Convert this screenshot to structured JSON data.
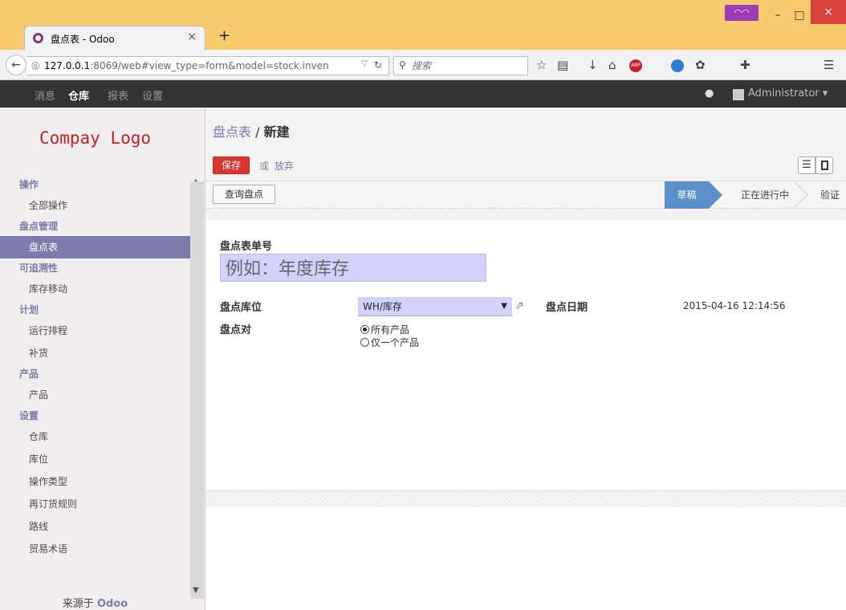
{
  "browser": {
    "tab_title": "盘点表 - Odoo",
    "new_tab": "+",
    "tab_close": "×",
    "url_host": "127.0.0.1",
    "url_rest": ":8069/web#view_type=form&model=stock.inven",
    "search_placeholder": "搜索",
    "window_close": "×",
    "window_min": "–",
    "window_max": "□"
  },
  "odoo_menu": {
    "items": [
      "消息",
      "仓库",
      "报表",
      "设置"
    ],
    "active": "仓库",
    "user": "Administrator ▾"
  },
  "sidebar": {
    "logo": "Compay Logo",
    "sections": [
      {
        "title": "操作",
        "items": [
          "全部操作"
        ]
      },
      {
        "title": "盘点管理",
        "items": [
          "盘点表"
        ]
      },
      {
        "title": "可追溯性",
        "items": [
          "库存移动"
        ]
      },
      {
        "title": "计划",
        "items": [
          "运行排程",
          "补货"
        ]
      },
      {
        "title": "产品",
        "items": [
          "产品"
        ]
      },
      {
        "title": "设置",
        "items": [
          "仓库",
          "库位",
          "操作类型",
          "再订货规则",
          "路线",
          "贸易术语"
        ]
      }
    ],
    "active_item": "盘点表",
    "powered_prefix": "来源于",
    "powered_brand": "Odoo"
  },
  "control_panel": {
    "breadcrumb_parent": "盘点表",
    "breadcrumb_sep": " / ",
    "breadcrumb_current": "新建",
    "save_label": "保存",
    "or_label": "或",
    "discard_label": "放弃"
  },
  "statusbar": {
    "query_button": "查询盘点",
    "stages": [
      "草稿",
      "正在进行中",
      "验证"
    ],
    "active_stage": "草稿"
  },
  "form": {
    "name_label": "盘点表单号",
    "name_placeholder": "例如：年度库存",
    "location_label": "盘点库位",
    "location_value": "WH/库存",
    "date_label": "盘点日期",
    "date_value": "2015-04-16 12:14:56",
    "filter_label": "盘点对",
    "filter_options": [
      "所有产品",
      "仅一个产品"
    ],
    "filter_selected": "所有产品"
  },
  "colors": {
    "brand": "#7c7bad",
    "save": "#dc3431",
    "stage_active": "#5a8fc9",
    "logo": "#c91e2a"
  }
}
